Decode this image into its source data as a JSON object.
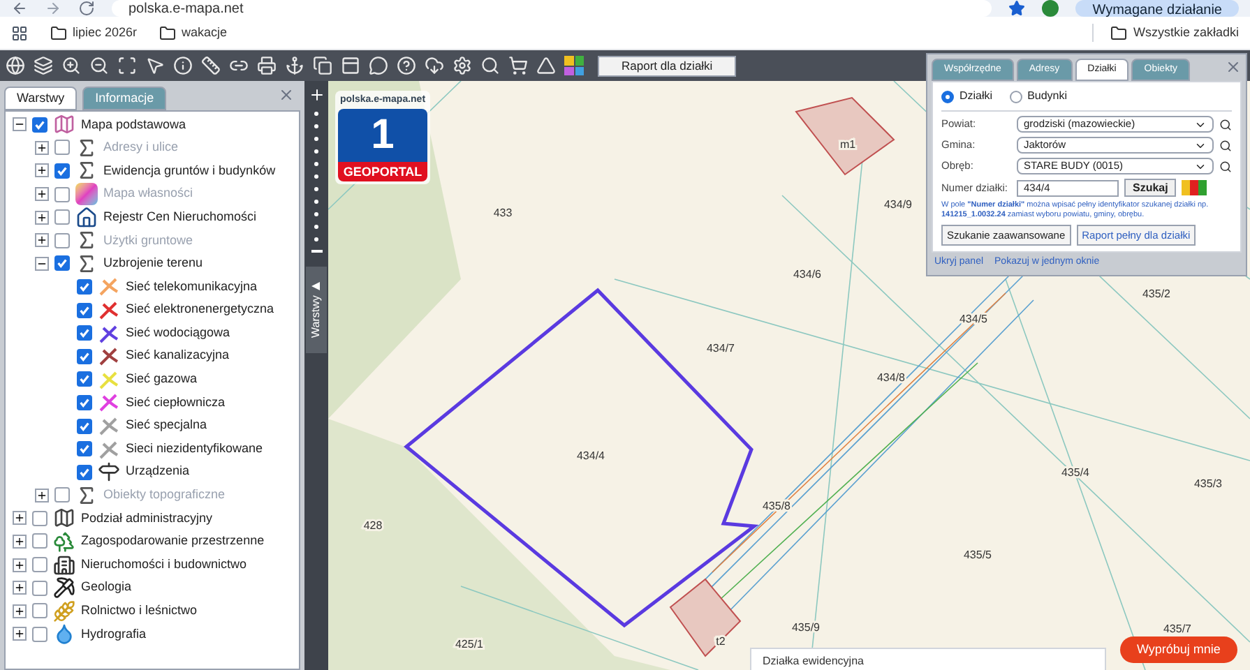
{
  "browser": {
    "url": "polska.e-mapa.net",
    "action_button": "Wymagane działanie",
    "bookmarks": [
      "lipiec 2026r",
      "wakacje"
    ],
    "all_bookmarks": "Wszystkie zakładki"
  },
  "toolbar": {
    "report_button": "Raport dla działki"
  },
  "layers_panel": {
    "tabs": [
      {
        "label": "Warstwy",
        "selected": true
      },
      {
        "label": "Informacje",
        "selected": false
      }
    ],
    "tree": [
      {
        "label": "Mapa podstawowa",
        "kind": "map",
        "checked": true,
        "expanded": true,
        "disabled": false,
        "children": [
          {
            "label": "Adresy i ulice",
            "kind": "sigma",
            "checked": false,
            "expanded": false,
            "disabled": true
          },
          {
            "label": "Ewidencja gruntów i budynków",
            "kind": "sigma",
            "checked": true,
            "expanded": false,
            "disabled": false
          },
          {
            "label": "Mapa własności",
            "kind": "tile",
            "checked": false,
            "expanded": false,
            "disabled": true
          },
          {
            "label": "Rejestr Cen Nieruchomości",
            "kind": "house",
            "checked": false,
            "expanded": false,
            "disabled": false
          },
          {
            "label": "Użytki gruntowe",
            "kind": "sigma",
            "checked": false,
            "expanded": false,
            "disabled": true
          },
          {
            "label": "Uzbrojenie terenu",
            "kind": "sigma",
            "checked": true,
            "expanded": true,
            "disabled": false,
            "children": [
              {
                "label": "Sieć telekomunikacyjna",
                "kind": "network",
                "color": "#f4a460",
                "checked": true,
                "disabled": false
              },
              {
                "label": "Sieć elektronenergetyczna",
                "kind": "network",
                "color": "#e03030",
                "checked": true,
                "disabled": false
              },
              {
                "label": "Sieć wodociągowa",
                "kind": "network",
                "color": "#6040e0",
                "checked": true,
                "disabled": false
              },
              {
                "label": "Sieć kanalizacyjna",
                "kind": "network",
                "color": "#a04040",
                "checked": true,
                "disabled": false
              },
              {
                "label": "Sieć gazowa",
                "kind": "network",
                "color": "#e8e040",
                "checked": true,
                "disabled": false
              },
              {
                "label": "Sieć ciepłownicza",
                "kind": "network",
                "color": "#e040e0",
                "checked": true,
                "disabled": false
              },
              {
                "label": "Sieć specjalna",
                "kind": "network",
                "color": "#a0a0a0",
                "checked": true,
                "disabled": false
              },
              {
                "label": "Sieci niezidentyfikowane",
                "kind": "network",
                "color": "#a0a0a0",
                "checked": true,
                "disabled": false
              },
              {
                "label": "Urządzenia",
                "kind": "sign",
                "checked": true,
                "disabled": false
              }
            ]
          },
          {
            "label": "Obiekty topograficzne",
            "kind": "sigma",
            "checked": false,
            "expanded": false,
            "disabled": true
          }
        ]
      },
      {
        "label": "Podział administracyjny",
        "kind": "admin",
        "checked": false,
        "expanded": false,
        "disabled": false
      },
      {
        "label": "Zagospodarowanie przestrzenne",
        "kind": "tree",
        "checked": false,
        "expanded": false,
        "disabled": false
      },
      {
        "label": "Nieruchomości i budownictwo",
        "kind": "building",
        "checked": false,
        "expanded": false,
        "disabled": false
      },
      {
        "label": "Geologia",
        "kind": "tools",
        "checked": false,
        "expanded": false,
        "disabled": false
      },
      {
        "label": "Rolnictwo i leśnictwo",
        "kind": "farm",
        "checked": false,
        "expanded": false,
        "disabled": false
      },
      {
        "label": "Hydrografia",
        "kind": "drop",
        "checked": false,
        "expanded": false,
        "disabled": false
      }
    ]
  },
  "side_strip": {
    "tab": "Warstwy"
  },
  "logo": {
    "site": "polska.e-mapa.net",
    "number": "1",
    "name": "GEOPORTAL"
  },
  "map": {
    "labels": [
      "433",
      "434/9",
      "434/6",
      "434/7",
      "434/5",
      "434/8",
      "434/4",
      "435/8",
      "435/4",
      "435/3",
      "435/2",
      "435/5",
      "435/9",
      "435/7",
      "428",
      "425/1",
      "m1",
      "t2"
    ],
    "popup": "Działka ewidencyjna",
    "try_button": "Wypróbuj mnie"
  },
  "search_panel": {
    "tabs": [
      {
        "label": "Współrzędne",
        "selected": false
      },
      {
        "label": "Adresy",
        "selected": false
      },
      {
        "label": "Działki",
        "selected": true
      },
      {
        "label": "Obiekty",
        "selected": false
      }
    ],
    "modes": [
      {
        "label": "Działki",
        "selected": true
      },
      {
        "label": "Budynki",
        "selected": false
      }
    ],
    "fields": [
      {
        "label": "Powiat:",
        "value": "grodziski (mazowieckie)"
      },
      {
        "label": "Gmina:",
        "value": "Jaktorów"
      },
      {
        "label": "Obręb:",
        "value": "STARE BUDY (0015)"
      }
    ],
    "parcel": {
      "label": "Numer działki:",
      "value": "434/4",
      "button": "Szukaj",
      "swatches": [
        {
          "color": "#f0c020"
        },
        {
          "color": "#e02020"
        },
        {
          "color": "#30a030"
        }
      ]
    },
    "hint": "W pole **\"Numer działki\"** można wpisać pełny identyfikator szukanej działki np. **141215_1.0032.24** zamiast wyboru powiatu, gminy, obrębu.",
    "buttons": [
      "Szukanie zaawansowane",
      "Raport pełny dla działki"
    ],
    "links": [
      "Ukryj panel",
      "Pokazuj w jednym oknie"
    ]
  }
}
